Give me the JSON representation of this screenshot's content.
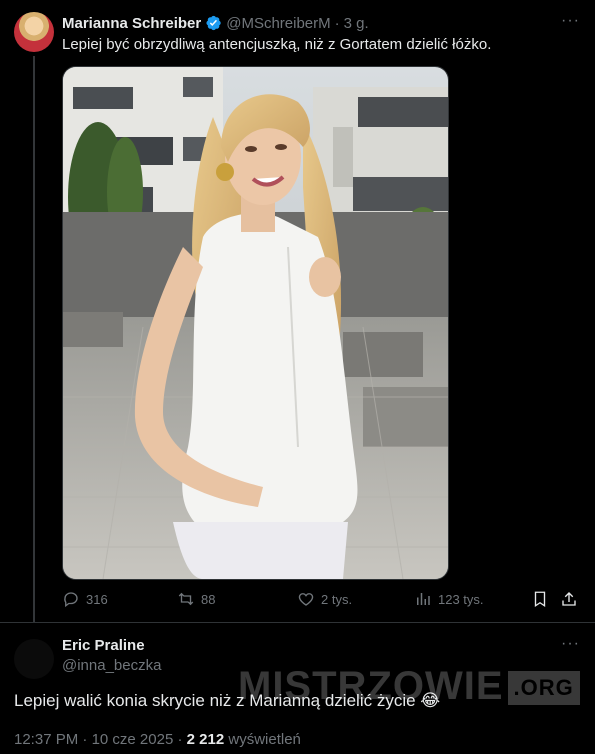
{
  "tweet": {
    "author_name": "Marianna Schreiber",
    "handle": "@MSchreiberM",
    "separator": "·",
    "time_ago": "3 g.",
    "text": "Lepiej być obrzydliwą antencjuszką, niż z Gortatem dzielić łóżko.",
    "more_label": "···",
    "actions": {
      "replies": "316",
      "reposts": "88",
      "likes": "2 tys.",
      "views": "123 tys."
    }
  },
  "reply": {
    "author_name": "Eric Praline",
    "handle": "@inna_beczka",
    "more_label": "···",
    "text": "Lepiej walić konia skrycie niż z Marianną dzielić życie",
    "emoji": "😂",
    "time": "12:37 PM",
    "date": "10 cze 2025",
    "views_count": "2 212",
    "views_label": "wyświetleń"
  },
  "watermark": {
    "main": "MISTRZOWIE",
    "suffix": ".ORG"
  },
  "colors": {
    "background": "#000000",
    "text": "#e7e9ea",
    "muted": "#71767b",
    "verified": "#1d9bf0"
  }
}
